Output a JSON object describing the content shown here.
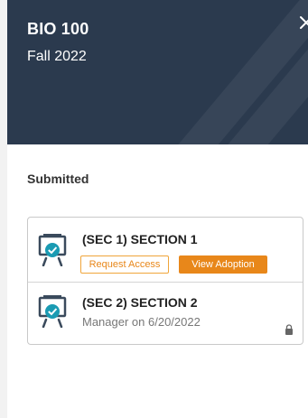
{
  "course": {
    "code": "BIO 100",
    "term": "Fall 2022"
  },
  "status_label": "Submitted",
  "sections": [
    {
      "title": "(SEC 1) SECTION 1",
      "buttons": {
        "request_access": "Request Access",
        "view_adoption": "View Adoption"
      }
    },
    {
      "title": "(SEC 2) SECTION 2",
      "subtitle": "Manager on 6/20/2022"
    }
  ],
  "icons": {
    "close": "close-icon",
    "section": "presentation-check-icon",
    "lock": "lock-icon"
  },
  "colors": {
    "header_bg": "#2b3a4e",
    "accent": "#e8871a",
    "icon_teal": "#1a9bb3"
  }
}
